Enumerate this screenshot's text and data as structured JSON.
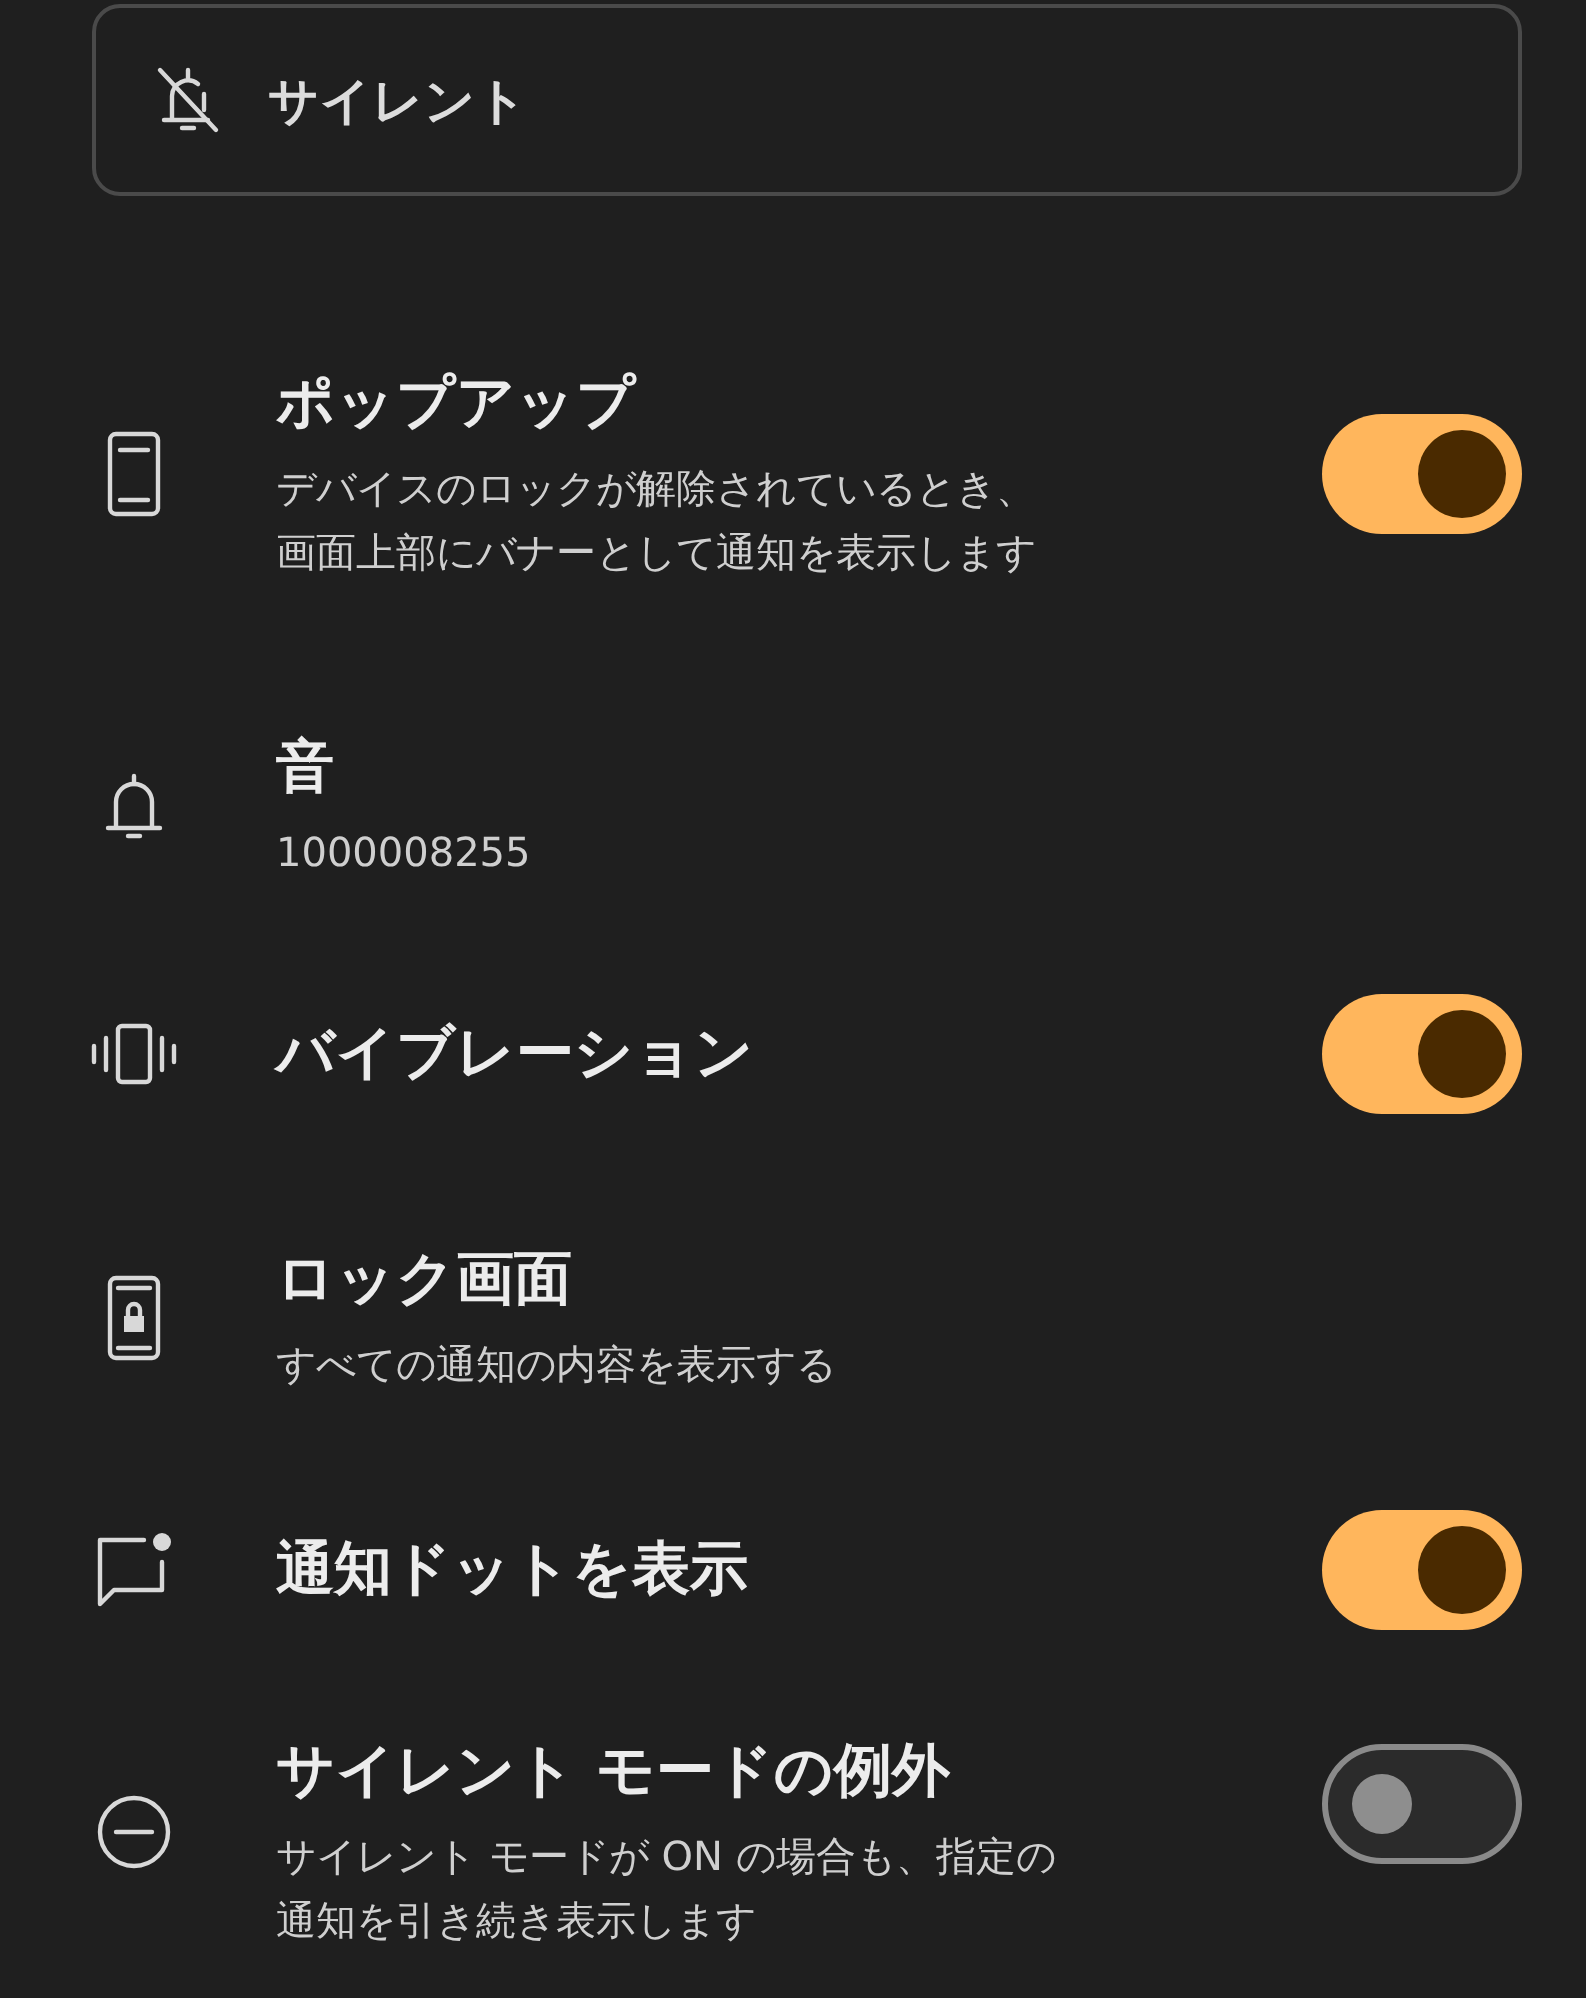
{
  "mode_card": {
    "label": "サイレント"
  },
  "settings": [
    {
      "kind": "popup",
      "title": "ポップアップ",
      "description": [
        "デバイスのロックが解除されているとき、",
        "画面上部にバナーとして通知を表示します"
      ],
      "toggle": {
        "on": true
      }
    },
    {
      "kind": "sound",
      "title": "音",
      "description": [
        "1000008255"
      ]
    },
    {
      "kind": "vibration",
      "title": "バイブレーション",
      "toggle": {
        "on": true
      }
    },
    {
      "kind": "lockscreen",
      "title": "ロック画面",
      "description": [
        "すべての通知の内容を表示する"
      ]
    },
    {
      "kind": "dot",
      "title": "通知ドットを表示",
      "toggle": {
        "on": true
      }
    },
    {
      "kind": "dnd",
      "title": "サイレント モードの例外",
      "description": [
        "サイレント モードが ON の場合も、指定の",
        "通知を引き続き表示します"
      ],
      "toggle": {
        "on": false
      }
    }
  ]
}
